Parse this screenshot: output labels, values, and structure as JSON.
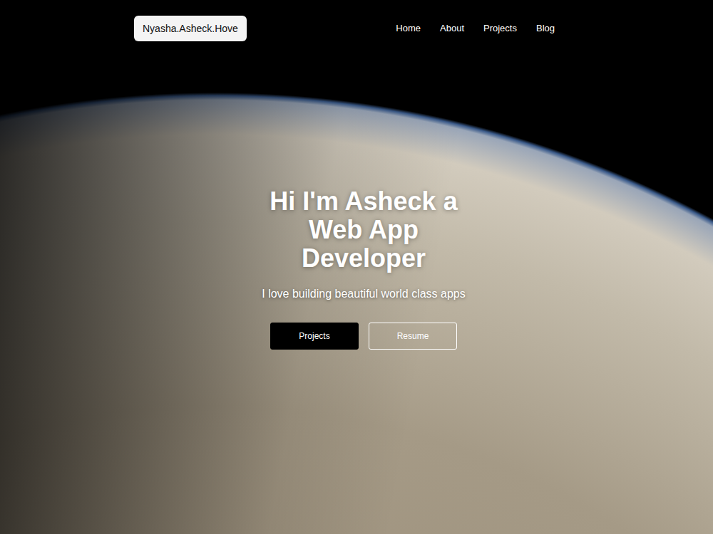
{
  "brand": "Nyasha.Asheck.Hove",
  "nav": {
    "items": [
      {
        "label": "Home",
        "selected": false
      },
      {
        "label": "About",
        "selected": false
      },
      {
        "label": "Projects",
        "selected": false
      },
      {
        "label": "Blog",
        "selected": false
      }
    ]
  },
  "hero": {
    "title": "Hi I'm Asheck a Web App Developer",
    "subtitle": "I love building beautiful world class apps",
    "buttons": [
      {
        "label": "Projects",
        "kind": "solid"
      },
      {
        "label": "Resume",
        "kind": "outline"
      }
    ]
  }
}
